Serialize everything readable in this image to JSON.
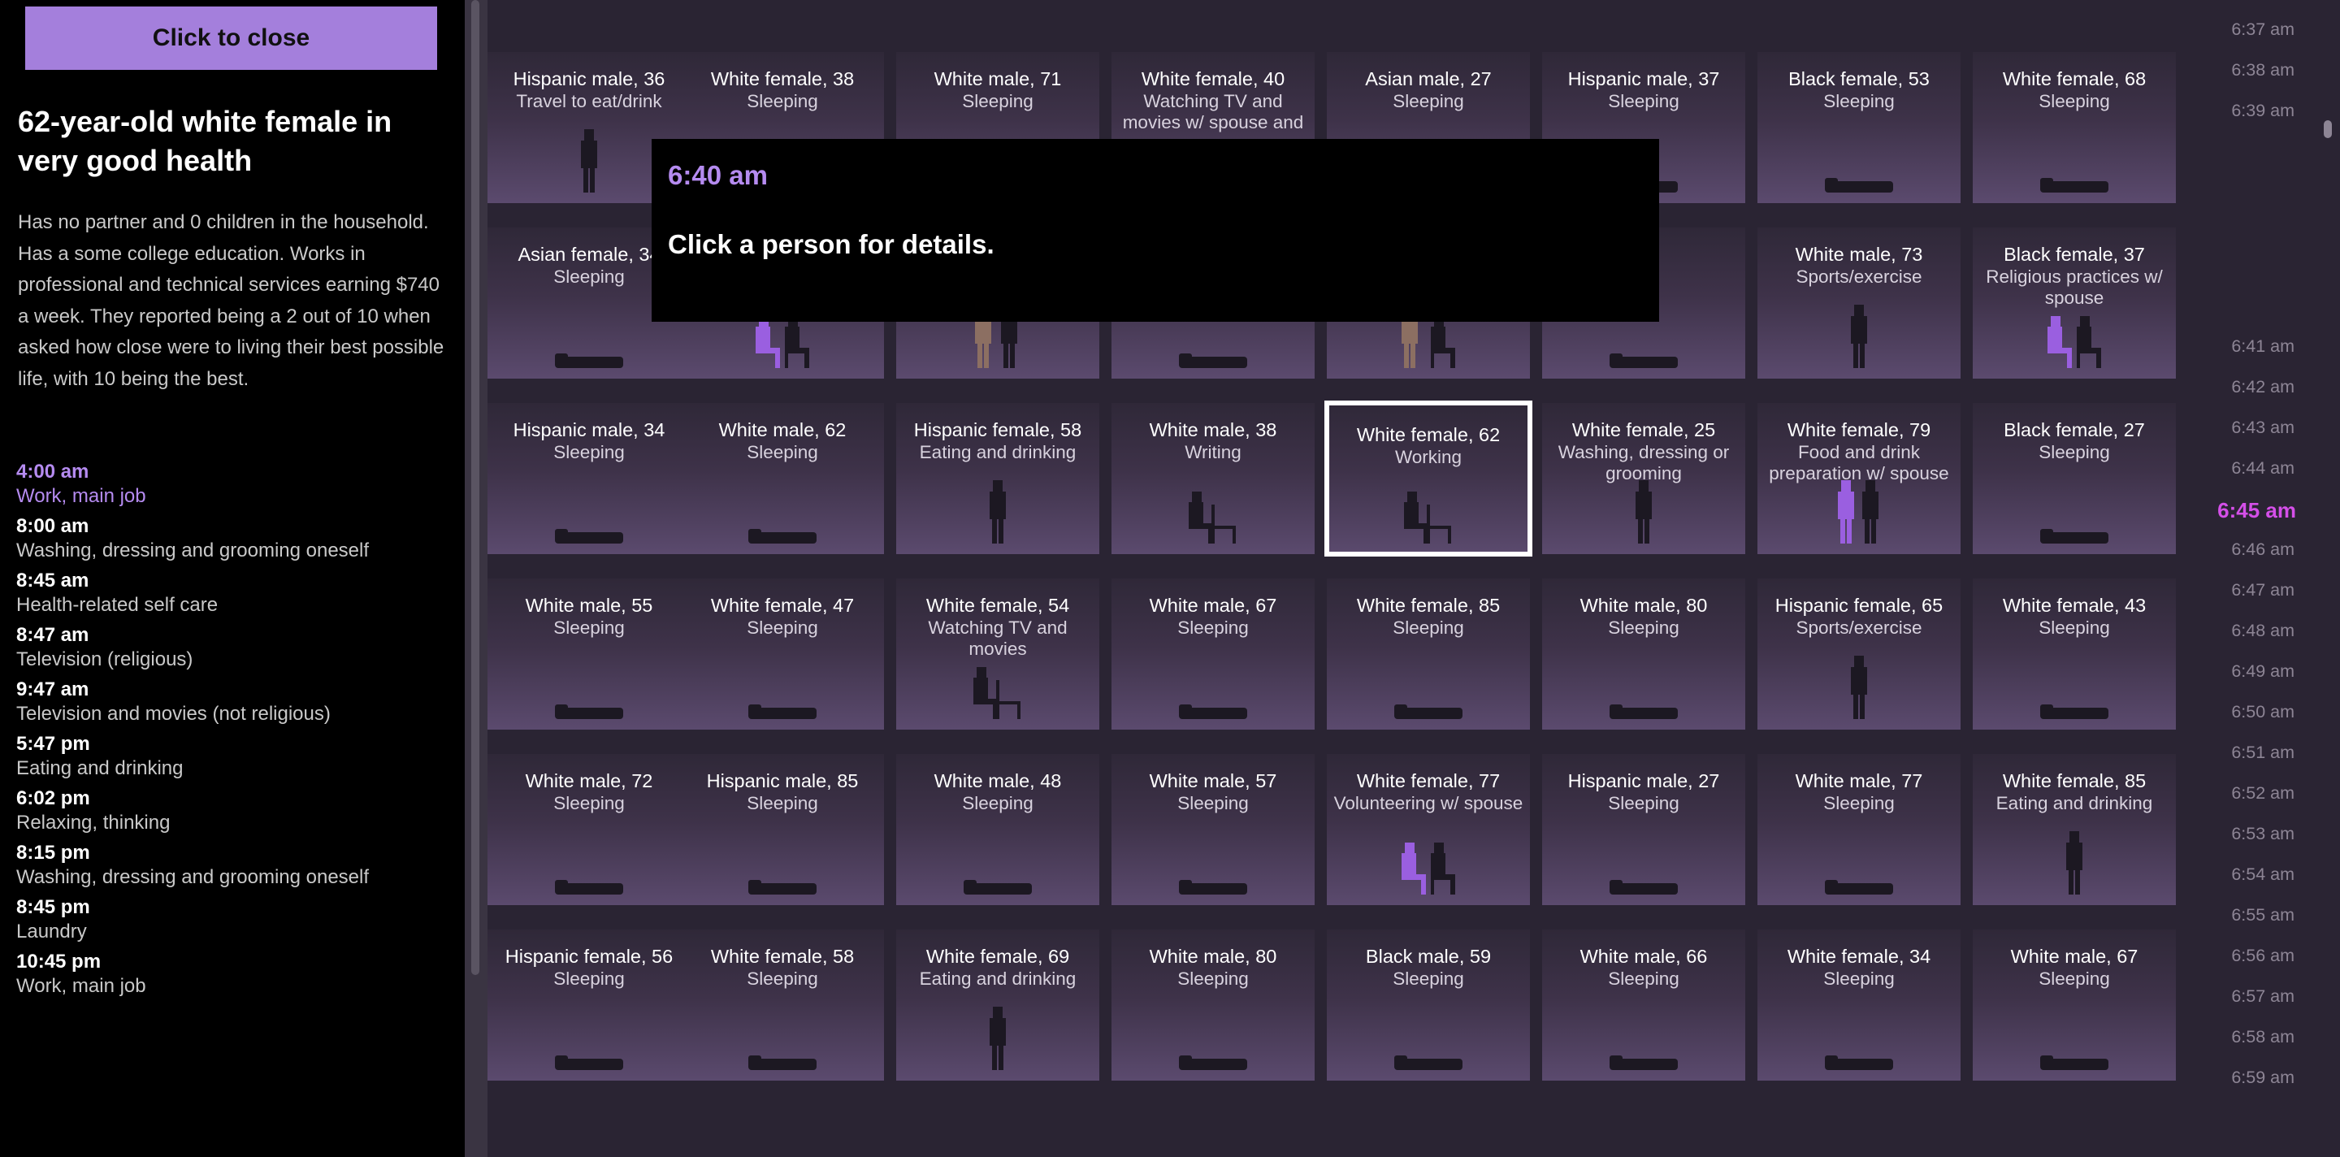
{
  "panel": {
    "close_label": "Click to close",
    "title": "62-year-old white female in very good health",
    "description": "Has no partner and 0 children in the household. Has a some college education. Works in professional and technical services earning $740 a week. They reported being a 2 out of 10 when asked how close were to living their best possible life, with 10 being the best.",
    "schedule": [
      {
        "time": "4:00 am",
        "activity": "Work, main job",
        "current": true
      },
      {
        "time": "8:00 am",
        "activity": "Washing, dressing and grooming oneself"
      },
      {
        "time": "8:45 am",
        "activity": "Health-related self care"
      },
      {
        "time": "8:47 am",
        "activity": "Television (religious)"
      },
      {
        "time": "9:47 am",
        "activity": "Television and movies (not religious)"
      },
      {
        "time": "5:47 pm",
        "activity": "Eating and drinking"
      },
      {
        "time": "6:02 pm",
        "activity": "Relaxing, thinking"
      },
      {
        "time": "8:15 pm",
        "activity": "Washing, dressing and grooming oneself"
      },
      {
        "time": "8:45 pm",
        "activity": "Laundry"
      },
      {
        "time": "10:45 pm",
        "activity": "Work, main job"
      }
    ]
  },
  "overlay": {
    "time": "6:40 am",
    "message": "Click a person for details."
  },
  "grid": {
    "rows": [
      [
        {
          "name": "Hispanic male, 36",
          "activity": "Travel to eat/drink",
          "pose": "stand"
        },
        {
          "name": "White female, 38",
          "activity": "Sleeping",
          "pose": "sleep"
        },
        {
          "name": "White male, 71",
          "activity": "Sleeping",
          "pose": "sleep"
        },
        {
          "name": "White female, 40",
          "activity": "Watching TV and movies w/ spouse and",
          "pose": "sleep"
        },
        {
          "name": "Asian male, 27",
          "activity": "Sleeping",
          "pose": "sleep"
        },
        {
          "name": "Hispanic male, 37",
          "activity": "Sleeping",
          "pose": "sleep"
        },
        {
          "name": "Black female, 53",
          "activity": "Sleeping",
          "pose": "sleep"
        },
        {
          "name": "White female, 68",
          "activity": "Sleeping",
          "pose": "sleep"
        }
      ],
      [
        {
          "name": "Asian female, 34",
          "activity": "Sleeping",
          "pose": "sleep"
        },
        {
          "name": "",
          "activity": "",
          "pose": "sit-purple"
        },
        {
          "name": "",
          "activity": "",
          "pose": "stand-pair"
        },
        {
          "name": "",
          "activity": "",
          "pose": "sleep"
        },
        {
          "name": "",
          "activity": "",
          "pose": "sit-pair"
        },
        {
          "name": "",
          "activity": "",
          "pose": "sleep"
        },
        {
          "name": "White male, 73",
          "activity": "Sports/exercise",
          "pose": "stand"
        },
        {
          "name": "Black female, 37",
          "activity": "Religious practices w/ spouse",
          "pose": "sit-purple"
        }
      ],
      [
        {
          "name": "Hispanic male, 34",
          "activity": "Sleeping",
          "pose": "sleep"
        },
        {
          "name": "White male, 62",
          "activity": "Sleeping",
          "pose": "sleep"
        },
        {
          "name": "Hispanic female, 58",
          "activity": "Eating and drinking",
          "pose": "stand"
        },
        {
          "name": "White male, 38",
          "activity": "Writing",
          "pose": "sit"
        },
        {
          "name": "White female, 62",
          "activity": "Working",
          "pose": "sit",
          "selected": true
        },
        {
          "name": "White female, 25",
          "activity": "Washing, dressing or grooming",
          "pose": "stand"
        },
        {
          "name": "White female, 79",
          "activity": "Food and drink preparation w/ spouse",
          "pose": "stand-purple"
        },
        {
          "name": "Black female, 27",
          "activity": "Sleeping",
          "pose": "sleep"
        }
      ],
      [
        {
          "name": "White male, 55",
          "activity": "Sleeping",
          "pose": "sleep"
        },
        {
          "name": "White female, 47",
          "activity": "Sleeping",
          "pose": "sleep"
        },
        {
          "name": "White female, 54",
          "activity": "Watching TV and movies",
          "pose": "sit"
        },
        {
          "name": "White male, 67",
          "activity": "Sleeping",
          "pose": "sleep"
        },
        {
          "name": "White female, 85",
          "activity": "Sleeping",
          "pose": "sleep"
        },
        {
          "name": "White male, 80",
          "activity": "Sleeping",
          "pose": "sleep"
        },
        {
          "name": "Hispanic female, 65",
          "activity": "Sports/exercise",
          "pose": "stand"
        },
        {
          "name": "White female, 43",
          "activity": "Sleeping",
          "pose": "sleep"
        }
      ],
      [
        {
          "name": "White male, 72",
          "activity": "Sleeping",
          "pose": "sleep"
        },
        {
          "name": "Hispanic male, 85",
          "activity": "Sleeping",
          "pose": "sleep"
        },
        {
          "name": "White male, 48",
          "activity": "Sleeping",
          "pose": "sleep"
        },
        {
          "name": "White male, 57",
          "activity": "Sleeping",
          "pose": "sleep"
        },
        {
          "name": "White female, 77",
          "activity": "Volunteering w/ spouse",
          "pose": "sit-purple"
        },
        {
          "name": "Hispanic male, 27",
          "activity": "Sleeping",
          "pose": "sleep"
        },
        {
          "name": "White male, 77",
          "activity": "Sleeping",
          "pose": "sleep"
        },
        {
          "name": "White female, 85",
          "activity": "Eating and drinking",
          "pose": "stand"
        }
      ],
      [
        {
          "name": "Hispanic female, 56",
          "activity": "Sleeping",
          "pose": "sleep"
        },
        {
          "name": "White female, 58",
          "activity": "Sleeping",
          "pose": "sleep"
        },
        {
          "name": "White female, 69",
          "activity": "Eating and drinking",
          "pose": "stand"
        },
        {
          "name": "White male, 80",
          "activity": "Sleeping",
          "pose": "sleep"
        },
        {
          "name": "Black male, 59",
          "activity": "Sleeping",
          "pose": "sleep"
        },
        {
          "name": "White male, 66",
          "activity": "Sleeping",
          "pose": "sleep"
        },
        {
          "name": "White female, 34",
          "activity": "Sleeping",
          "pose": "sleep"
        },
        {
          "name": "White male, 67",
          "activity": "Sleeping",
          "pose": "sleep"
        }
      ]
    ]
  },
  "timeline": {
    "ticks": [
      "6:37 am",
      "6:38 am",
      "6:39 am",
      "6:41 am",
      "6:42 am",
      "6:43 am",
      "6:44 am",
      "6:45 am",
      "6:46 am",
      "6:47 am",
      "6:48 am",
      "6:49 am",
      "6:50 am",
      "6:51 am",
      "6:52 am",
      "6:53 am",
      "6:54 am",
      "6:55 am",
      "6:56 am",
      "6:57 am",
      "6:58 am",
      "6:59 am"
    ],
    "current": "6:45 am"
  },
  "colors": {
    "accent": "#a47fdc",
    "current_time": "#d44fe8",
    "background": "#2a2433"
  }
}
